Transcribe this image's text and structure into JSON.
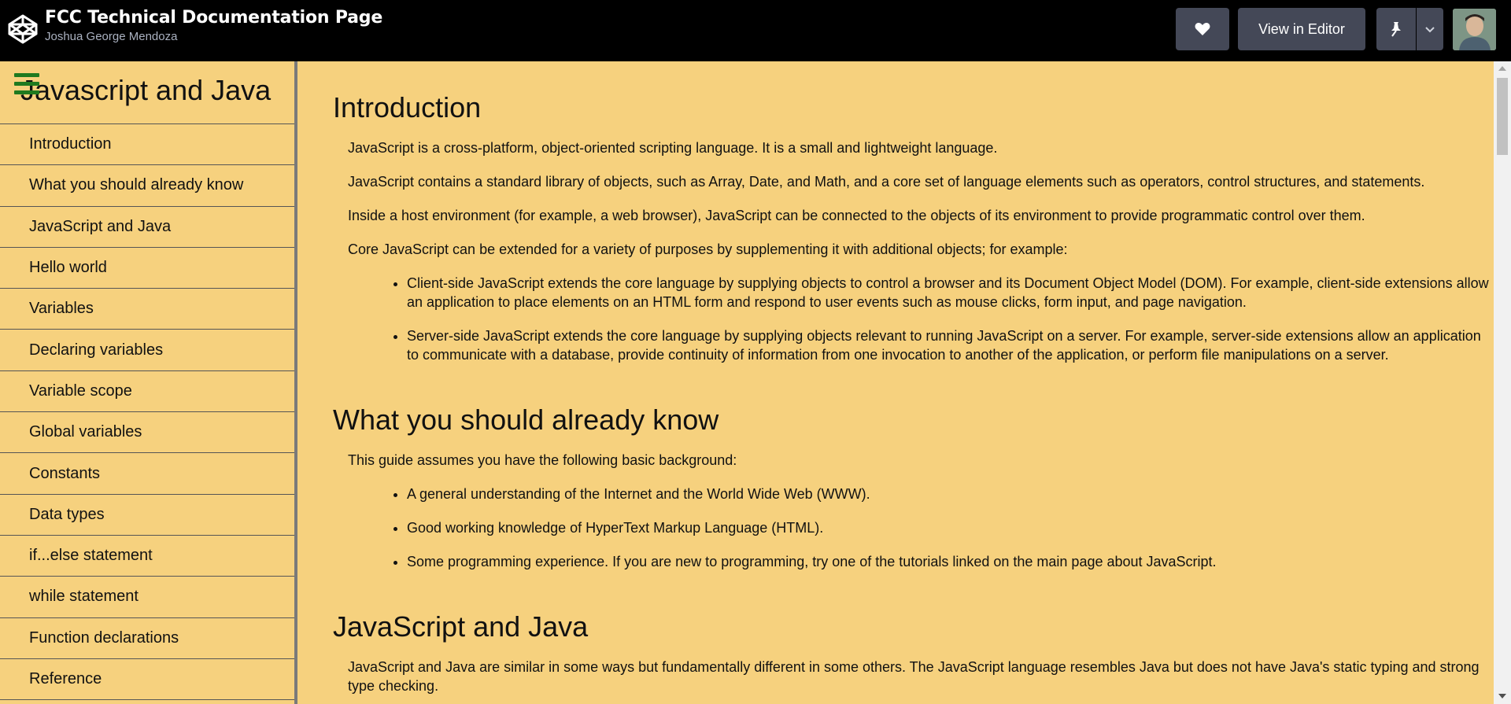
{
  "header": {
    "title": "FCC Technical Documentation Page",
    "author": "Joshua George Mendoza",
    "heart_icon": "heart-icon",
    "editor_label": "View in Editor",
    "pin_icon": "pin-icon",
    "caret_icon": "chevron-down-icon"
  },
  "sidebar": {
    "title": "Javascript and Java",
    "menu_icon": "hamburger-icon",
    "items": [
      {
        "label": "Introduction"
      },
      {
        "label": "What you should already know"
      },
      {
        "label": "JavaScript and Java"
      },
      {
        "label": "Hello world"
      },
      {
        "label": "Variables"
      },
      {
        "label": "Declaring variables"
      },
      {
        "label": "Variable scope"
      },
      {
        "label": "Global variables"
      },
      {
        "label": "Constants"
      },
      {
        "label": "Data types"
      },
      {
        "label": "if...else statement"
      },
      {
        "label": "while statement"
      },
      {
        "label": "Function declarations"
      },
      {
        "label": "Reference"
      }
    ]
  },
  "main": {
    "intro": {
      "heading": "Introduction",
      "p1": "JavaScript is a cross-platform, object-oriented scripting language. It is a small and lightweight language.",
      "p2": "JavaScript contains a standard library of objects, such as Array, Date, and Math, and a core set of language elements such as operators, control structures, and statements.",
      "p3": "Inside a host environment (for example, a web browser), JavaScript can be connected to the objects of its environment to provide programmatic control over them.",
      "p4": "Core JavaScript can be extended for a variety of purposes by supplementing it with additional objects; for example:",
      "li1": "Client-side JavaScript extends the core language by supplying objects to control a browser and its Document Object Model (DOM). For example, client-side extensions allow an application to place elements on an HTML form and respond to user events such as mouse clicks, form input, and page navigation.",
      "li2": "Server-side JavaScript extends the core language by supplying objects relevant to running JavaScript on a server. For example, server-side extensions allow an application to communicate with a database, provide continuity of information from one invocation to another of the application, or perform file manipulations on a server."
    },
    "know": {
      "heading": "What you should already know",
      "p1": "This guide assumes you have the following basic background:",
      "li1": "A general understanding of the Internet and the World Wide Web (WWW).",
      "li2": "Good working knowledge of HyperText Markup Language (HTML).",
      "li3": "Some programming experience. If you are new to programming, try one of the tutorials linked on the main page about JavaScript."
    },
    "java": {
      "heading": "JavaScript and Java",
      "p1": "JavaScript and Java are similar in some ways but fundamentally different in some others. The JavaScript language resembles Java but does not have Java's static typing and strong type checking."
    }
  },
  "colors": {
    "topbar": "#000000",
    "content_bg": "#f6d17e",
    "button_bg": "#444857",
    "hamburger": "#1f7a1f"
  }
}
